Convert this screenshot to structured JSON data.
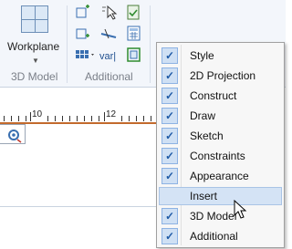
{
  "ribbon": {
    "workplane_label": "Workplane",
    "group_3d_label": "3D Model",
    "group_additional_label": "Additional",
    "tools_additional": [
      {
        "icon": "add-point-icon"
      },
      {
        "icon": "select-arrow-icon"
      },
      {
        "icon": "check-document-icon"
      },
      {
        "icon": "add-frame-icon"
      },
      {
        "icon": "measure-tool-icon"
      },
      {
        "icon": "calculator-icon"
      },
      {
        "icon": "grid-pattern-icon"
      },
      {
        "icon": "variable-icon"
      },
      {
        "icon": "bracket-frame-icon"
      }
    ]
  },
  "ruler": {
    "numbers": [
      "10",
      "12"
    ]
  },
  "context_menu": {
    "items": [
      {
        "label": "Style",
        "checked": true
      },
      {
        "label": "2D Projection",
        "checked": true
      },
      {
        "label": "Construct",
        "checked": true
      },
      {
        "label": "Draw",
        "checked": true
      },
      {
        "label": "Sketch",
        "checked": true
      },
      {
        "label": "Constraints",
        "checked": true
      },
      {
        "label": "Appearance",
        "checked": true
      },
      {
        "label": "Insert",
        "checked": false,
        "highlighted": true
      },
      {
        "label": "3D Model",
        "checked": true
      },
      {
        "label": "Additional",
        "checked": true
      }
    ]
  },
  "icons": {
    "var_text": "var|"
  }
}
